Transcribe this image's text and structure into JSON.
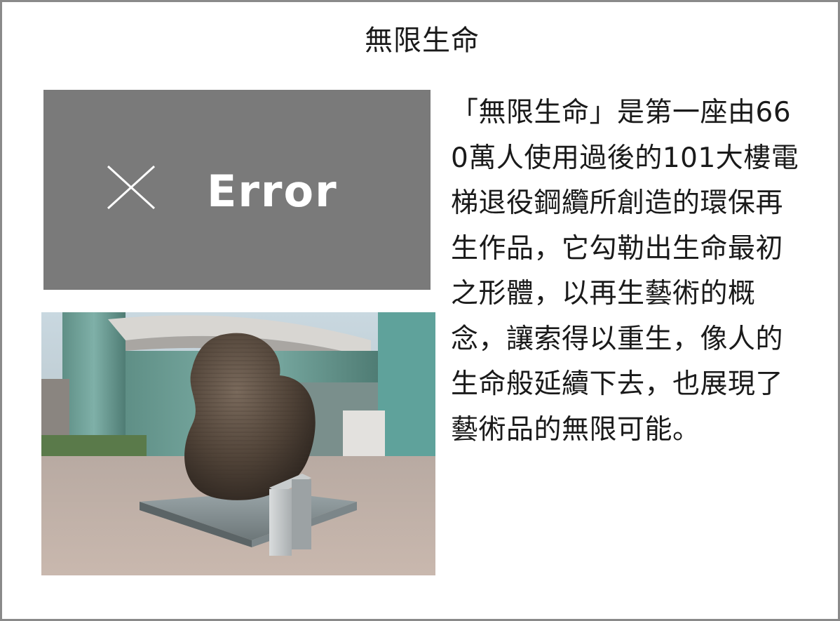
{
  "page": {
    "title": "無限生命"
  },
  "error_image": {
    "icon": "close-icon",
    "label": "Error",
    "background": "#7a7a7a"
  },
  "photo": {
    "subject": "sculpture-photo"
  },
  "description": {
    "text": "「無限生命」是第一座由660萬人使用過後的101大樓電梯退役鋼纜所創造的環保再生作品，它勾勒出生命最初之形體，以再生藝術的概念，讓索得以重生，像人的生命般延續下去，也展現了藝術品的無限可能。"
  }
}
